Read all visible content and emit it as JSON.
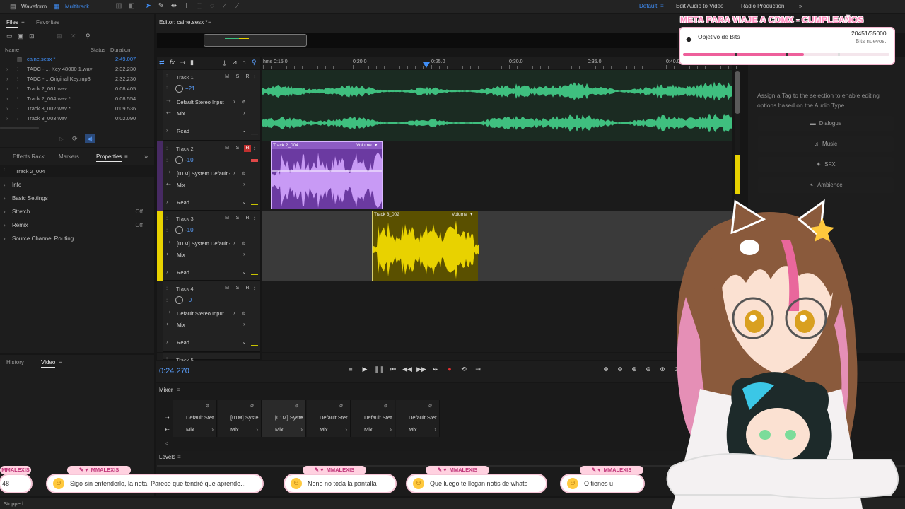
{
  "topbar": {
    "tabs": [
      {
        "label": "Waveform"
      },
      {
        "label": "Multitrack"
      }
    ],
    "workspaces": [
      "Default",
      "Edit Audio to Video",
      "Radio Production"
    ]
  },
  "files_panel": {
    "tabs": [
      "Files",
      "Favorites"
    ],
    "columns": {
      "name": "Name",
      "status": "Status",
      "duration": "Duration"
    },
    "files": [
      {
        "name": "caine.sesx *",
        "duration": "2:49.007"
      },
      {
        "name": "TADC - ... Key 48000 1.wav",
        "duration": "2:32.230"
      },
      {
        "name": "TADC - ...Original Key.mp3",
        "duration": "2:32.230"
      },
      {
        "name": "Track 2_001.wav",
        "duration": "0:08.405"
      },
      {
        "name": "Track 2_004.wav *",
        "duration": "0:08.554"
      },
      {
        "name": "Track 3_002.wav *",
        "duration": "0:09.536"
      },
      {
        "name": "Track 3_003.wav",
        "duration": "0:02.090"
      }
    ]
  },
  "props_panel": {
    "tabs": [
      "Effects Rack",
      "Markers",
      "Properties"
    ],
    "clip_name": "Track 2_004",
    "sections": [
      {
        "label": "Info",
        "value": ""
      },
      {
        "label": "Basic Settings",
        "value": ""
      },
      {
        "label": "Stretch",
        "value": "Off"
      },
      {
        "label": "Remix",
        "value": "Off"
      },
      {
        "label": "Source Channel Routing",
        "value": ""
      }
    ]
  },
  "history_panel": {
    "tabs": [
      "History",
      "Video"
    ]
  },
  "editor": {
    "title": "Editor: caine.sesx *",
    "time_labels": [
      "hms 0:15.0",
      "0:20.0",
      "0:25.0",
      "0:30.0",
      "0:35.0",
      "0:40.0"
    ],
    "current_time": "0:24.270",
    "tracks": [
      {
        "name": "Track 1",
        "volume": "+21",
        "input": "Default Stereo Input",
        "mix": "Mix",
        "mode": "Read"
      },
      {
        "name": "Track 2",
        "volume": "-10",
        "input": "[01M] System Default -",
        "mix": "Mix",
        "mode": "Read"
      },
      {
        "name": "Track 3",
        "volume": "-10",
        "input": "[01M] System Default -",
        "mix": "Mix",
        "mode": "Read"
      },
      {
        "name": "Track 4",
        "volume": "+0",
        "input": "Default Stereo Input",
        "mix": "Mix",
        "mode": "Read"
      },
      {
        "name": "Track 5"
      }
    ],
    "clips": [
      {
        "label": "Track 2_004",
        "param": "Volume"
      },
      {
        "label": "Track 3_002",
        "param": "Volume"
      }
    ],
    "colors": {
      "track1": "#3fbf7f",
      "track2": "#b77bf0",
      "track3": "#e8d200"
    }
  },
  "mixer": {
    "title": "Mixer",
    "channels": [
      {
        "input": "Default Stere",
        "mix": "Mix"
      },
      {
        "input": "[01M] Syster",
        "mix": "Mix"
      },
      {
        "input": "[01M] Syster",
        "mix": "Mix"
      },
      {
        "input": "Default Stere",
        "mix": "Mix"
      },
      {
        "input": "Default Stere",
        "mix": "Mix"
      },
      {
        "input": "Default Stere",
        "mix": "Mix"
      }
    ]
  },
  "levels": {
    "title": "Levels"
  },
  "status": {
    "text": "Stopped"
  },
  "essential_sound": {
    "message": "Assign a Tag to the selection to enable editing options based on the Audio Type.",
    "buttons": [
      "Dialogue",
      "Music",
      "SFX",
      "Ambience"
    ]
  },
  "overlay": {
    "goal_title": "META PARA VIAJE A CDMX - CUMPLEAÑOS",
    "goal_label": "Objetivo de Bits",
    "goal_current": 20451,
    "goal_target": 35000,
    "goal_value_text": "20451/35000",
    "goal_sub": "Bits nuevos.",
    "chat": [
      {
        "user": "MMALEXIS",
        "text": "48"
      },
      {
        "user": "MMALEXIS",
        "text": "Sigo sin entenderlo, la neta. Parece que tendré que aprende..."
      },
      {
        "user": "MMALEXIS",
        "text": "Nono no toda la pantalla"
      },
      {
        "user": "MMALEXIS",
        "text": "Que luego te llegan notis de whats"
      },
      {
        "user": "MMALEXIS",
        "text": "O tienes u"
      }
    ]
  }
}
